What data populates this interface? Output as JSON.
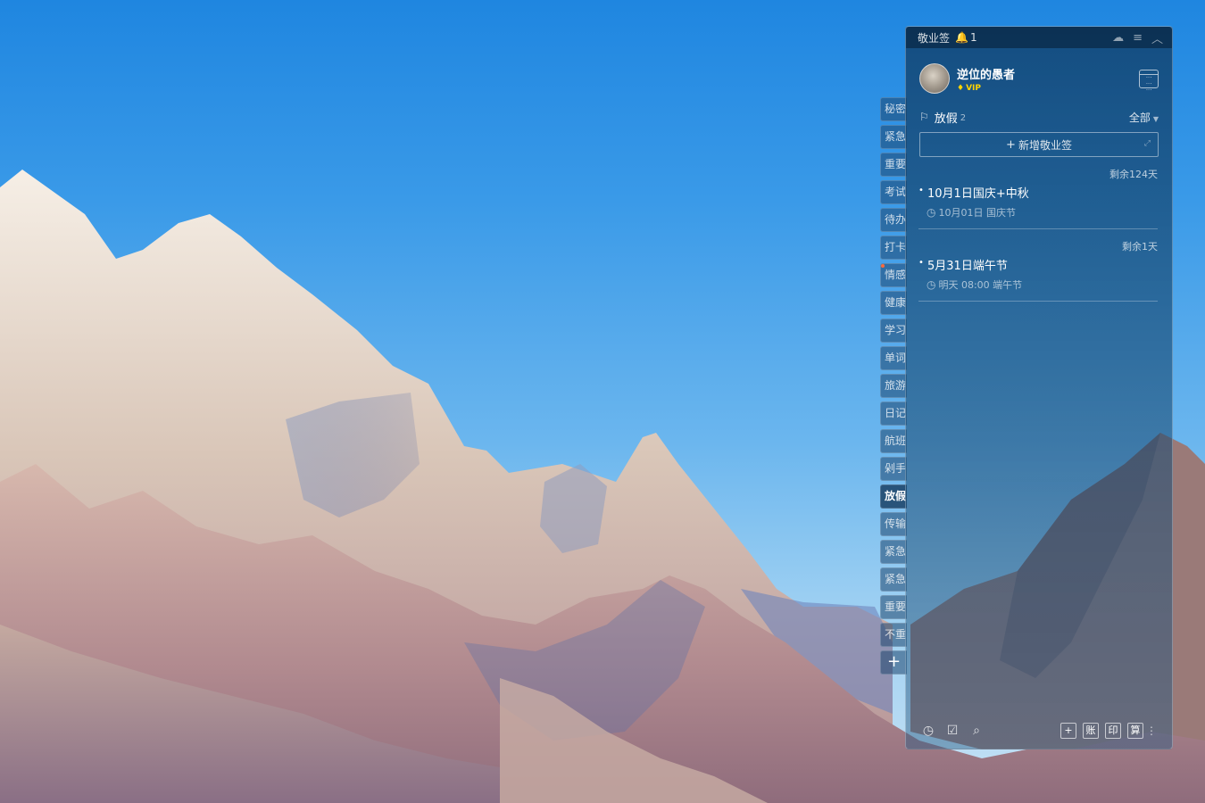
{
  "app": {
    "title": "敬业签",
    "notification_count": "1"
  },
  "colors": {
    "panel_bg": "#163c60",
    "accent_vip": "#ffd400",
    "notice_dot": "#ff6a3c"
  },
  "user": {
    "name": "逆位的愚者",
    "badge": "VIP"
  },
  "side_tabs": [
    {
      "label": "秘密"
    },
    {
      "label": "紧急"
    },
    {
      "label": "重要"
    },
    {
      "label": "考试"
    },
    {
      "label": "待办"
    },
    {
      "label": "打卡"
    },
    {
      "label": "情感"
    },
    {
      "label": "健康"
    },
    {
      "label": "学习"
    },
    {
      "label": "单词"
    },
    {
      "label": "旅游"
    },
    {
      "label": "日记"
    },
    {
      "label": "航班"
    },
    {
      "label": "剁手"
    },
    {
      "label": "放假"
    },
    {
      "label": "传输"
    },
    {
      "label": "紧急"
    },
    {
      "label": "紧急"
    },
    {
      "label": "重要"
    },
    {
      "label": "不重"
    }
  ],
  "side_add_label": "+",
  "category": {
    "name": "放假",
    "count": "2",
    "filter": "全部"
  },
  "add_button_label": "新增敬业签",
  "todos": [
    {
      "remaining": "剩余124天",
      "title": "10月1日国庆+中秋",
      "meta": "10月01日 国庆节"
    },
    {
      "remaining": "剩余1天",
      "title": "5月31日端午节",
      "meta": "明天 08:00 端午节"
    }
  ],
  "bottom": {
    "left_icons": [
      "clock-icon",
      "checklist-icon",
      "search-icon"
    ],
    "buttons": [
      "+",
      "账",
      "印",
      "算"
    ]
  }
}
